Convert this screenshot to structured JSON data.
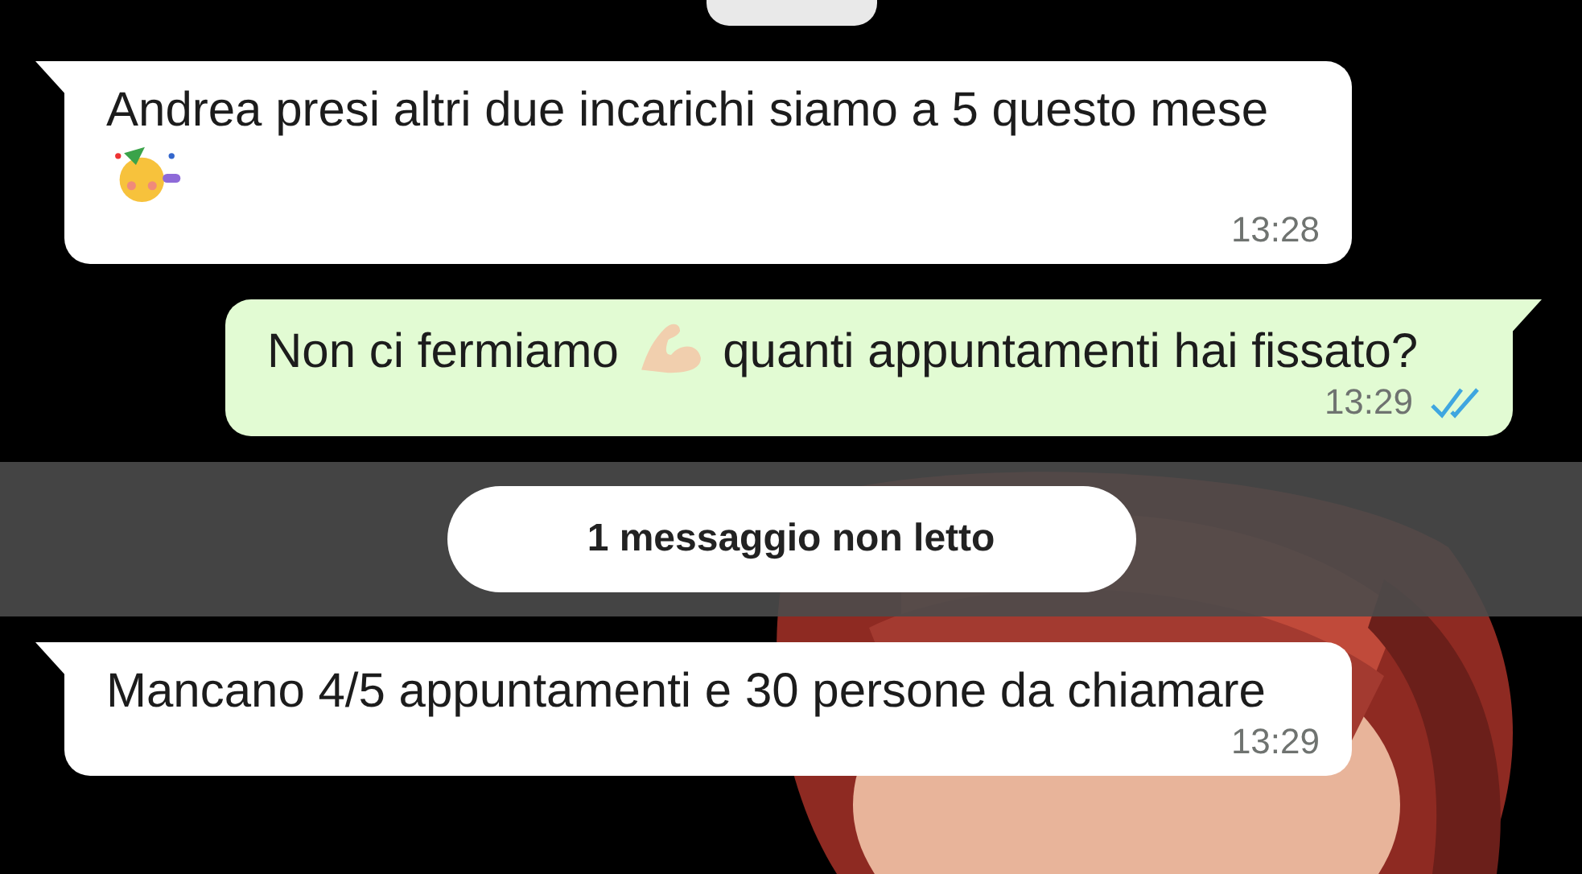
{
  "messages": [
    {
      "kind": "incoming",
      "segments": [
        {
          "kind": "text",
          "text": "Andrea presi altri due incarichi siamo a 5 questo mese"
        },
        {
          "kind": "party"
        }
      ],
      "time": "13:28"
    },
    {
      "kind": "outgoing",
      "segments": [
        {
          "kind": "text",
          "text": "Non ci fermiamo"
        },
        {
          "kind": "muscle"
        },
        {
          "kind": "text",
          "text": "quanti appuntamenti hai fissato?"
        }
      ],
      "time": "13:29",
      "read": true
    },
    {
      "kind": "divider",
      "text": "1 messaggio non letto"
    },
    {
      "kind": "incoming",
      "segments": [
        {
          "kind": "text",
          "text": "Mancano 4/5 appuntamenti e 30 persone da chiamare"
        }
      ],
      "time": "13:29"
    }
  ]
}
